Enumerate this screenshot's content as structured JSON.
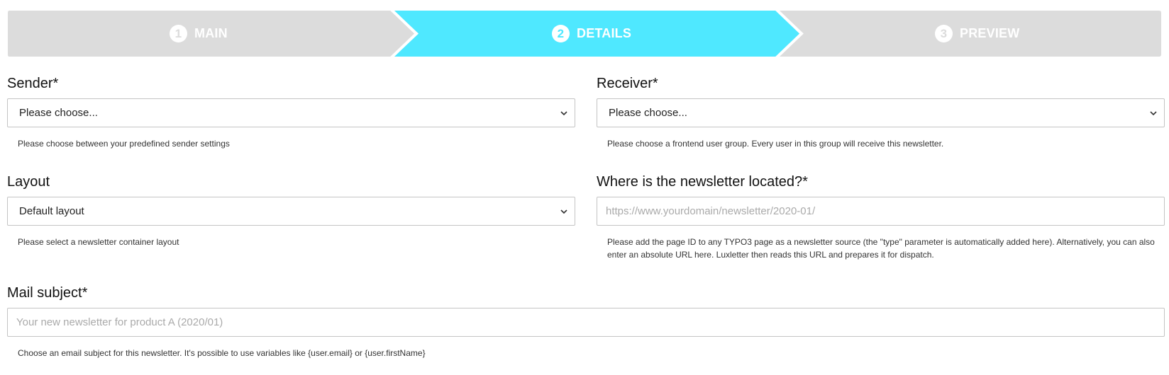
{
  "wizard": {
    "steps": [
      {
        "number": "1",
        "label": "MAIN"
      },
      {
        "number": "2",
        "label": "DETAILS"
      },
      {
        "number": "3",
        "label": "PREVIEW"
      }
    ],
    "colors": {
      "inactive": "#dcdcdc",
      "active": "#4fe8ff",
      "text": "#ffffff"
    }
  },
  "sender": {
    "label": "Sender*",
    "value": "Please choose...",
    "help": "Please choose between your predefined sender settings"
  },
  "receiver": {
    "label": "Receiver*",
    "value": "Please choose...",
    "help": "Please choose a frontend user group. Every user in this group will receive this newsletter."
  },
  "layout": {
    "label": "Layout",
    "value": "Default layout",
    "help": "Please select a newsletter container layout"
  },
  "origin": {
    "label": "Where is the newsletter located?*",
    "placeholder": "https://www.yourdomain/newsletter/2020-01/",
    "help": "Please add the page ID to any TYPO3 page as a newsletter source (the \"type\" parameter is automatically added here). Alternatively, you can also enter an absolute URL here. Luxletter then reads this URL and prepares it for dispatch."
  },
  "subject": {
    "label": "Mail subject*",
    "placeholder": "Your new newsletter for product A (2020/01)",
    "help": "Choose an email subject for this newsletter. It's possible to use variables like {user.email} or {user.firstName}"
  }
}
